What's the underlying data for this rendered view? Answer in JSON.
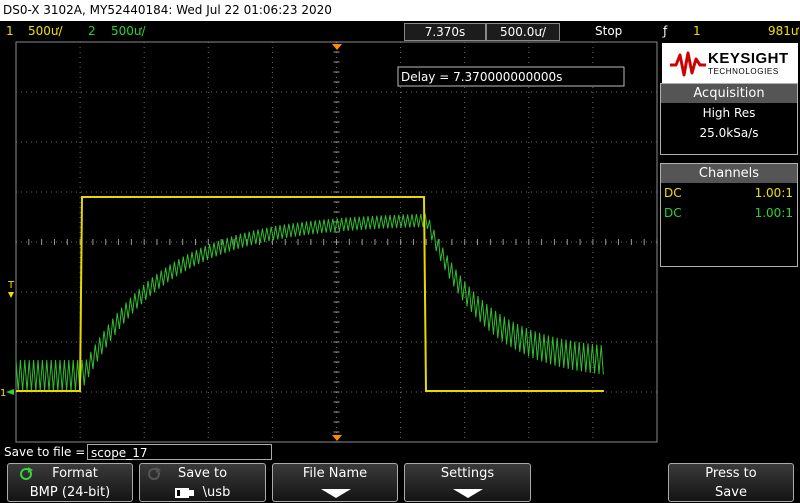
{
  "title_bar": "DS0-X 3102A, MY52440184: Wed Jul 22 01:06:23 2020",
  "status": {
    "ch1_num": "1",
    "ch1_scale": "500ư/",
    "ch2_num": "2",
    "ch2_scale": "500ư/",
    "time_delay": "7.370s",
    "time_scale": "500.0ư/",
    "run_state": "Stop",
    "trigger_symbol": "ƒ",
    "trigger_source": "1",
    "trigger_level": "981ư"
  },
  "delay_readout": "Delay = 7.370000000000s",
  "brand": {
    "name": "KEYSIGHT",
    "sub": "TECHNOLOGIES"
  },
  "acquisition": {
    "header": "Acquisition",
    "mode": "High Res",
    "rate": "25.0kSa/s"
  },
  "channels": {
    "header": "Channels",
    "rows": [
      {
        "coupling": "DC",
        "probe": "1.00:1"
      },
      {
        "coupling": "DC",
        "probe": "1.00:1"
      }
    ]
  },
  "save_to_file": {
    "label": "Save to file =",
    "value": "scope_17"
  },
  "softkeys": {
    "format": {
      "label": "Format",
      "value": "BMP (24-bit)"
    },
    "save_to": {
      "label": "Save to",
      "value": "\\usb"
    },
    "file_name": {
      "label": "File Name"
    },
    "settings": {
      "label": "Settings"
    },
    "press_to_save": {
      "label": "Press to",
      "value": "Save"
    }
  },
  "markers": {
    "trigger_level_marker": "T",
    "ch1_ground_marker": "1"
  },
  "colors": {
    "ch1": "#f0e000",
    "ch2": "#30d030",
    "grid": "#6a6a6a",
    "trigger": "#ff8c00"
  }
}
